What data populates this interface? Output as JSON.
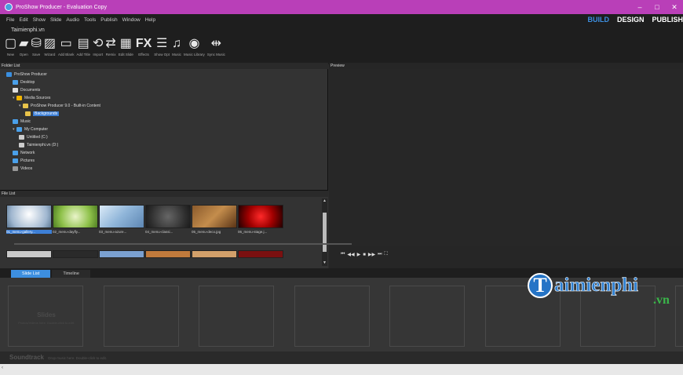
{
  "window": {
    "title": "ProShow Producer - Evaluation Copy",
    "minimize": "–",
    "maximize": "□",
    "close": "✕"
  },
  "menu": [
    "File",
    "Edit",
    "Show",
    "Slide",
    "Audio",
    "Tools",
    "Publish",
    "Window",
    "Help"
  ],
  "modes": [
    "BUILD",
    "DESIGN",
    "PUBLISH"
  ],
  "project_name": "Taimienphi.vn",
  "toolbar": [
    {
      "label": "New",
      "icon": "new-show-icon"
    },
    {
      "label": "Open",
      "icon": "open-folder-icon"
    },
    {
      "label": "Save",
      "icon": "save-icon"
    },
    {
      "label": "Wizard",
      "icon": "wizard-icon"
    },
    {
      "label": "Add Blank",
      "icon": "add-blank-icon"
    },
    {
      "label": "Add Title",
      "icon": "add-title-icon"
    },
    {
      "label": "Import",
      "icon": "import-icon"
    },
    {
      "label": "Remix",
      "icon": "remix-icon"
    },
    {
      "label": "Edit Slide",
      "icon": "edit-slide-icon"
    },
    {
      "label": "Effects",
      "icon": "fx-icon",
      "glyph": "FX"
    },
    {
      "label": "Show Opt",
      "icon": "show-options-icon"
    },
    {
      "label": "Music",
      "icon": "music-speaker-icon"
    },
    {
      "label": "Music Library",
      "icon": "music-library-icon"
    },
    {
      "label": "Sync Music",
      "icon": "sync-music-icon"
    }
  ],
  "panels": {
    "folder_list": "Folder List",
    "preview": "Preview",
    "file_list": "File List"
  },
  "tree": [
    {
      "label": "ProShow Producer",
      "icon": "app-icon",
      "level": 0
    },
    {
      "label": "Desktop",
      "icon": "desktop-icon",
      "level": 1
    },
    {
      "label": "Documents",
      "icon": "documents-icon",
      "level": 1
    },
    {
      "label": "Media Sources",
      "icon": "star-icon",
      "level": 1,
      "expanded": true
    },
    {
      "label": "ProShow Producer 9.0 - Built-in Content",
      "icon": "folder-icon",
      "level": 2,
      "expanded": true
    },
    {
      "label": "Backgrounds",
      "icon": "folder-icon",
      "level": 3,
      "selected": true
    },
    {
      "label": "Music",
      "icon": "music-icon",
      "level": 1
    },
    {
      "label": "My Computer",
      "icon": "computer-icon",
      "level": 1,
      "expanded": true
    },
    {
      "label": "Untitled (C:)",
      "icon": "drive-icon",
      "level": 2
    },
    {
      "label": "Taimienphi.vn (D:)",
      "icon": "drive-icon",
      "level": 2
    },
    {
      "label": "Network",
      "icon": "network-icon",
      "level": 1
    },
    {
      "label": "Pictures",
      "icon": "pictures-icon",
      "level": 1
    },
    {
      "label": "Videos",
      "icon": "videos-icon",
      "level": 1
    }
  ],
  "files": [
    {
      "name": "01_menu-gallery...",
      "selected": true
    },
    {
      "name": "02_menu-dayfly..."
    },
    {
      "name": "03_menu-azure..."
    },
    {
      "name": "04_menu-classi..."
    },
    {
      "name": "05_menu-deco.jpg"
    },
    {
      "name": "06_menu-stage.j..."
    }
  ],
  "transport": [
    "⏮",
    "◀◀",
    "▶",
    "■",
    "▶▶",
    "⏭",
    "⛶"
  ],
  "tabs": [
    {
      "label": "Slide List",
      "active": true
    },
    {
      "label": "Timeline"
    }
  ],
  "slides_placeholder": {
    "title": "Slides",
    "hint": "Photos/Videos here. Double-click to edit."
  },
  "soundtrack": {
    "title": "Soundtrack",
    "hint": "Drop music here. Double-click to edit."
  },
  "watermark": {
    "initial": "T",
    "text": "aimienphi",
    "tld": ".vn"
  },
  "colors": {
    "titlebar": "#b93fb8",
    "accent": "#3d8fe0",
    "selection": "#3d7fd6"
  }
}
